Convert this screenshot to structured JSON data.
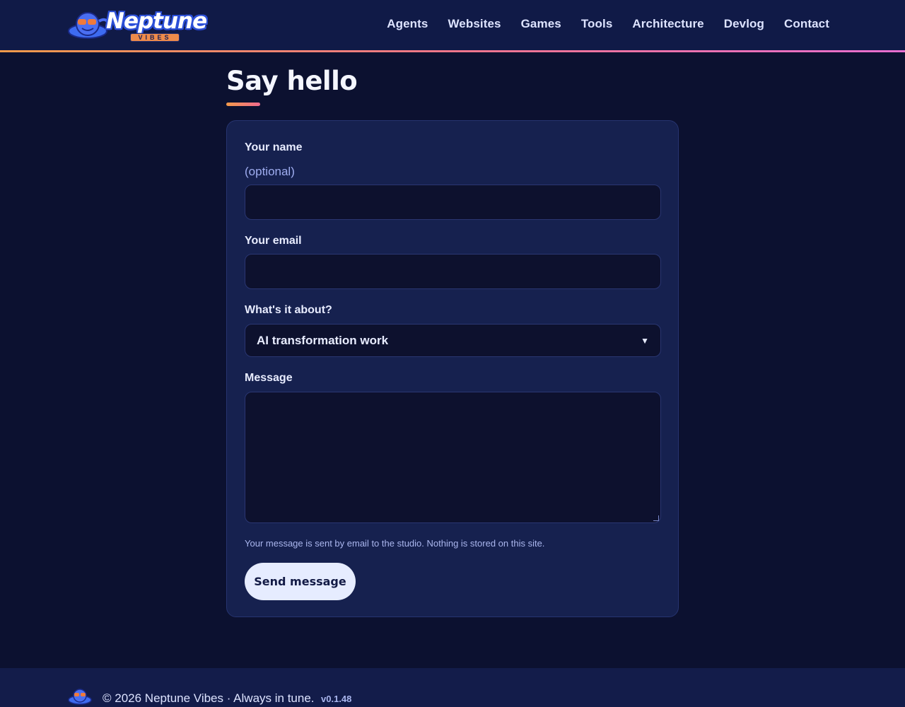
{
  "header": {
    "logo_text": "Neptune",
    "logo_sub": "VIBES",
    "nav": [
      "Agents",
      "Websites",
      "Games",
      "Tools",
      "Architecture",
      "Devlog",
      "Contact"
    ]
  },
  "page": {
    "title": "Say hello"
  },
  "form": {
    "name_label": "Your name",
    "name_hint": "(optional)",
    "name_value": "",
    "email_label": "Your email",
    "email_value": "",
    "topic_label": "What's it about?",
    "topic_value": "AI transformation work",
    "message_label": "Message",
    "message_value": "",
    "note": "Your message is sent by email to the studio. Nothing is stored on this site.",
    "send_label": "Send message"
  },
  "footer": {
    "text": "© 2026 Neptune Vibes · Always in tune.",
    "version": "v0.1.48"
  },
  "colors": {
    "background": "#0c1130",
    "header": "#101a47",
    "card": "#16214f",
    "accent_start": "#f39a4a",
    "accent_end": "#e86ed0"
  }
}
